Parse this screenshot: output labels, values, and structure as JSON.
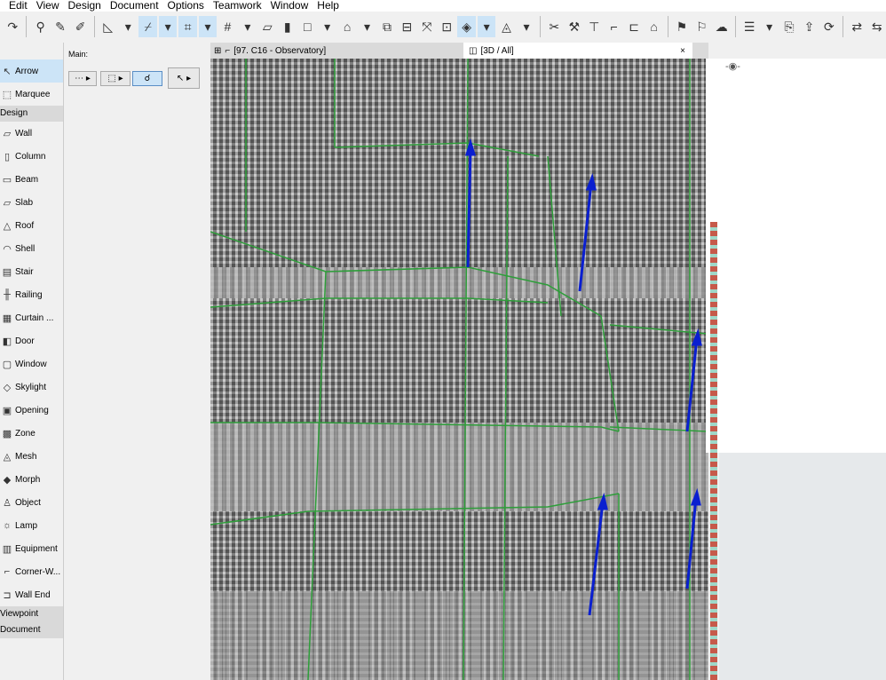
{
  "menu": [
    "Edit",
    "View",
    "Design",
    "Document",
    "Options",
    "Teamwork",
    "Window",
    "Help"
  ],
  "toolbox": {
    "items": [
      {
        "label": "Arrow",
        "selected": true
      },
      {
        "label": "Marquee"
      }
    ],
    "groups": [
      {
        "label": "Design",
        "items": [
          "Wall",
          "Column",
          "Beam",
          "Slab",
          "Roof",
          "Shell",
          "Stair",
          "Railing",
          "Curtain ...",
          "Door",
          "Window",
          "Skylight",
          "Opening",
          "Zone",
          "Mesh",
          "Morph",
          "Object",
          "Lamp",
          "Equipment",
          "Corner-W...",
          "Wall End"
        ]
      },
      {
        "label": "Viewpoint"
      },
      {
        "label": "Document"
      }
    ]
  },
  "infobox": {
    "main_label": "Main:"
  },
  "tabs": [
    {
      "label": "[97. C16 - Observatory]"
    },
    {
      "label": "[3D / All]",
      "active": true,
      "close": "×"
    }
  ],
  "colors": {
    "accent": "#cce4f7",
    "arrow": "#0a1fd0",
    "edge": "#2e9e3a"
  }
}
